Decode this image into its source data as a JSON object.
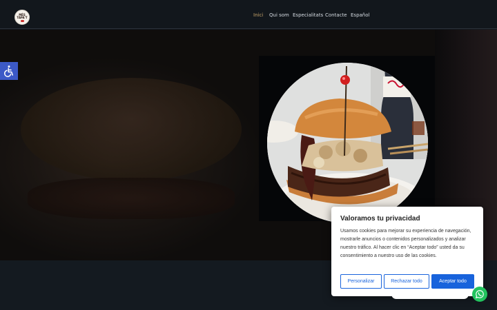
{
  "header": {
    "logo_alt": "Més Tapa't",
    "logo_text_line1": "MÉS",
    "logo_text_line2": "TAPA'T",
    "nav": [
      {
        "label": "Inici",
        "active": true
      },
      {
        "label": "Qui som",
        "active": false
      },
      {
        "label": "Especialitats",
        "active": false
      },
      {
        "label": "Contacte",
        "active": false
      },
      {
        "label": "Español",
        "active": false
      }
    ],
    "active_color": "#c9a66b"
  },
  "accessibility": {
    "icon": "wheelchair-icon",
    "color": "#3c59c7"
  },
  "cookie": {
    "title": "Valoramos tu privacidad",
    "text": "Usamos cookies para mejorar su experiencia de navegación, mostrarle anuncios o contenidos personalizados y analizar nuestro tráfico. Al hacer clic en “Aceptar todo” usted da su consentimiento a nuestro uso de las cookies.",
    "buttons": {
      "customize": "Personalizar",
      "reject": "Rechazar todo",
      "accept": "Aceptar todo"
    },
    "accent": "#1863dc"
  },
  "chat": {
    "icon": "whatsapp-icon",
    "color": "#22c35e"
  }
}
